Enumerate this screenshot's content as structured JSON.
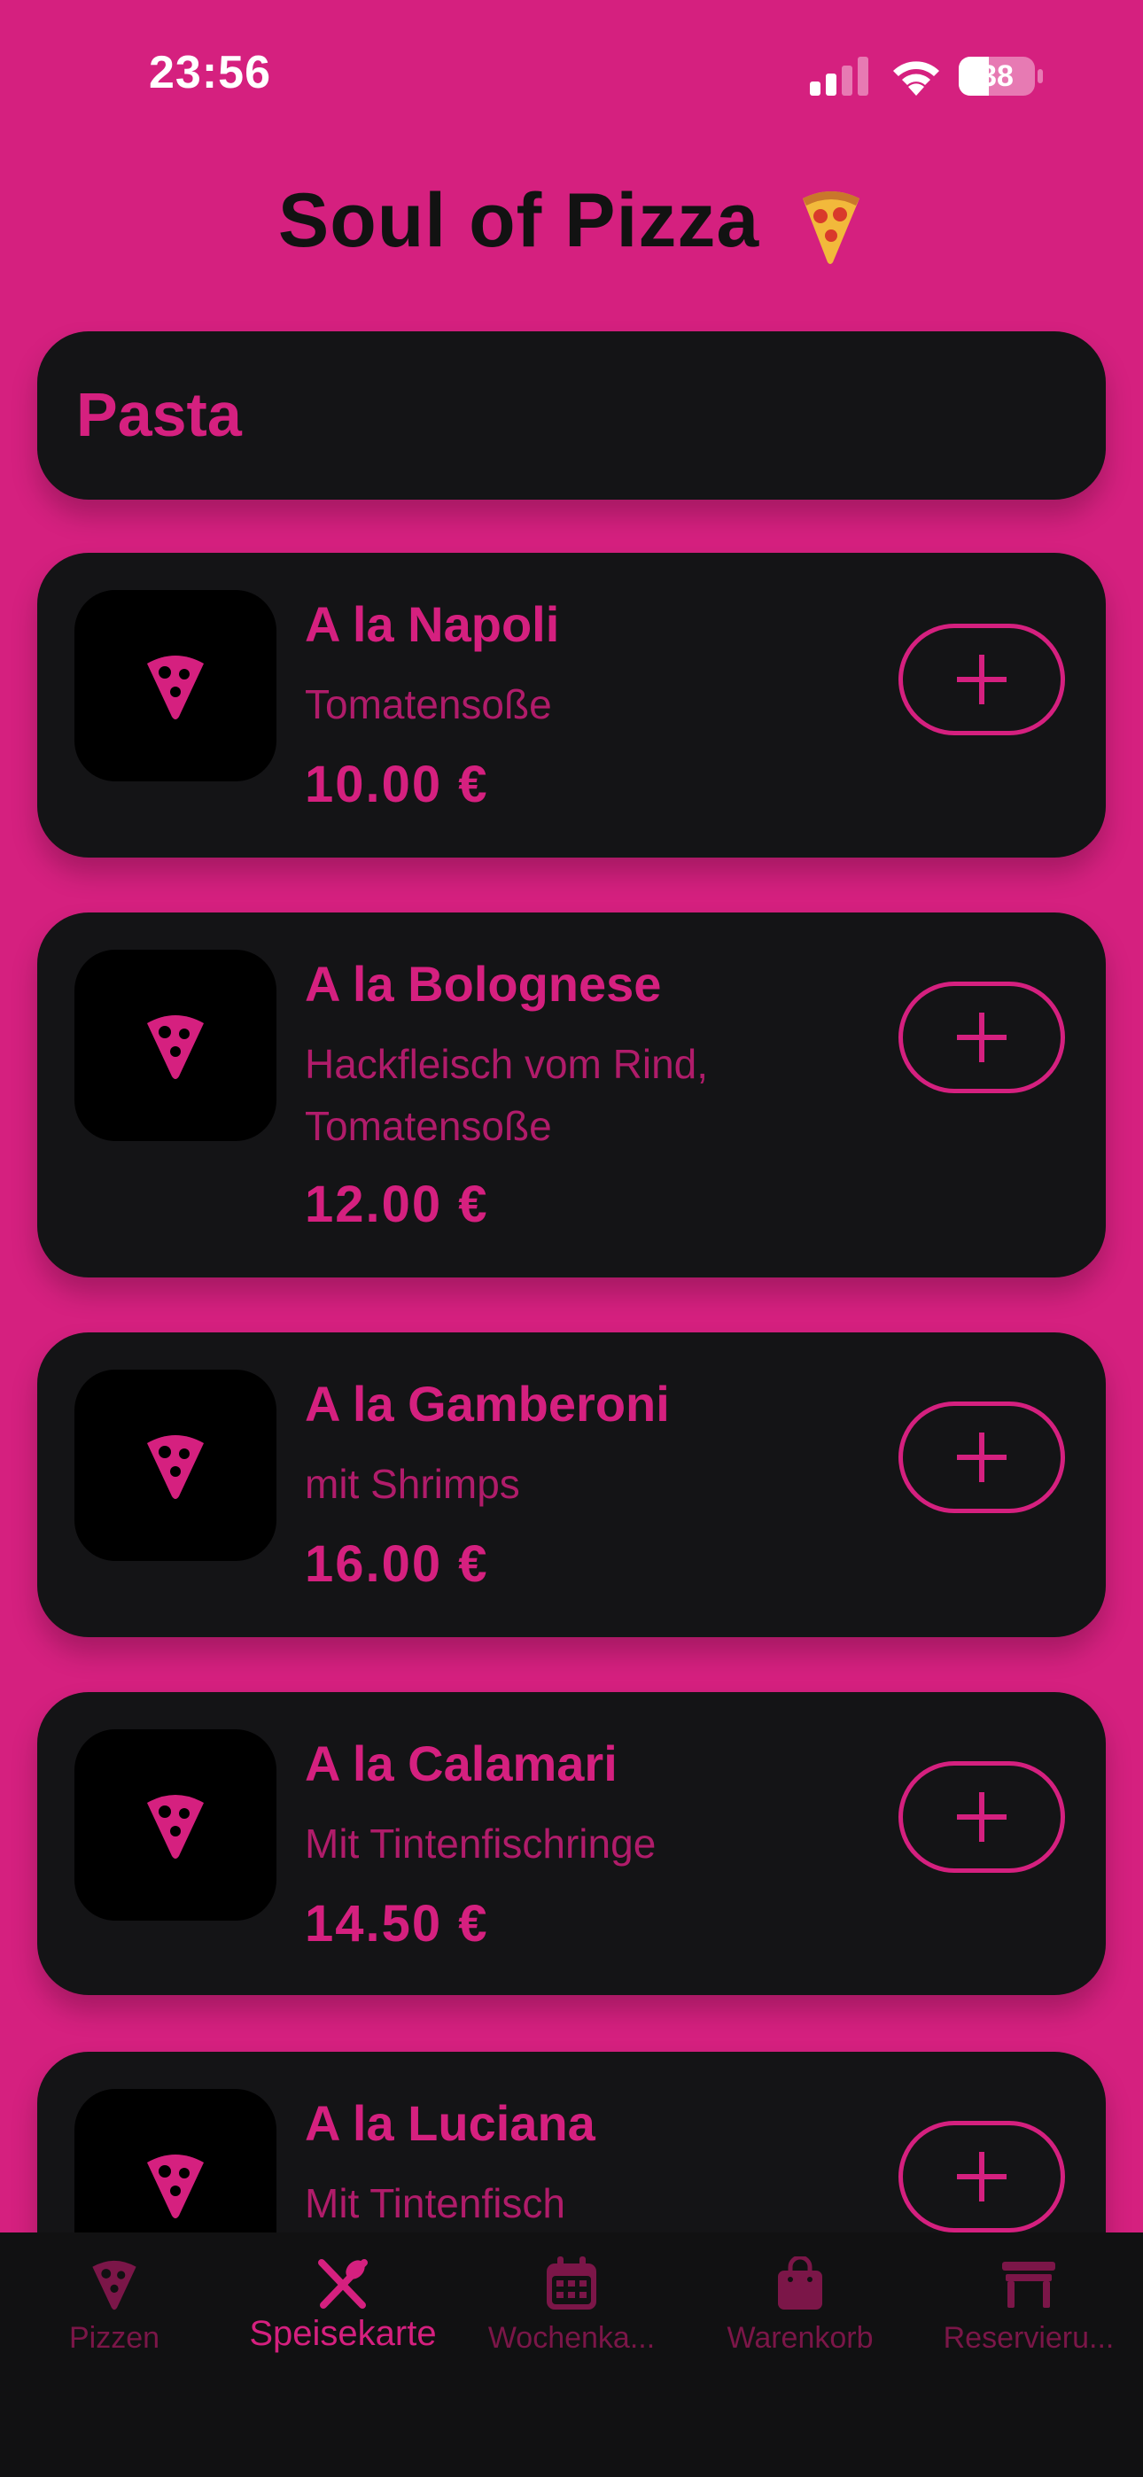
{
  "status_bar": {
    "time": "23:56",
    "battery_level": "38"
  },
  "app": {
    "title": "Soul of Pizza",
    "title_emoji": "pizza-emoji"
  },
  "section": {
    "title": "Pasta"
  },
  "items": [
    {
      "name": "A la Napoli",
      "description": "Tomatensoße",
      "price": "10.00 €",
      "icon": "pizza-slice-icon"
    },
    {
      "name": "A la Bolognese",
      "description": "Hackfleisch vom Rind, Tomatensoße",
      "price": "12.00 €",
      "icon": "pizza-slice-icon"
    },
    {
      "name": "A la Gamberoni",
      "description": "mit Shrimps",
      "price": "16.00 €",
      "icon": "pizza-slice-icon"
    },
    {
      "name": "A la Calamari",
      "description": "Mit Tintenfischringe",
      "price": "14.50 €",
      "icon": "pizza-slice-icon"
    },
    {
      "name": "A la Luciana",
      "description": "Mit Tintenfisch",
      "price": "",
      "icon": "pizza-slice-icon"
    }
  ],
  "tabs": [
    {
      "label": "Pizzen",
      "icon": "pizza-slice-icon",
      "active": false
    },
    {
      "label": "Speisekarte",
      "icon": "fork-knife-icon",
      "active": true
    },
    {
      "label": "Wochenka...",
      "icon": "calendar-icon",
      "active": false
    },
    {
      "label": "Warenkorb",
      "icon": "shopping-bag-icon",
      "active": false
    },
    {
      "label": "Reservieru...",
      "icon": "table-icon",
      "active": false
    }
  ],
  "colors": {
    "background": "#D5207F",
    "card": "#141416",
    "accent": "#D5207F",
    "tab_bar": "#111112",
    "tab_inactive": "#7B1648"
  }
}
